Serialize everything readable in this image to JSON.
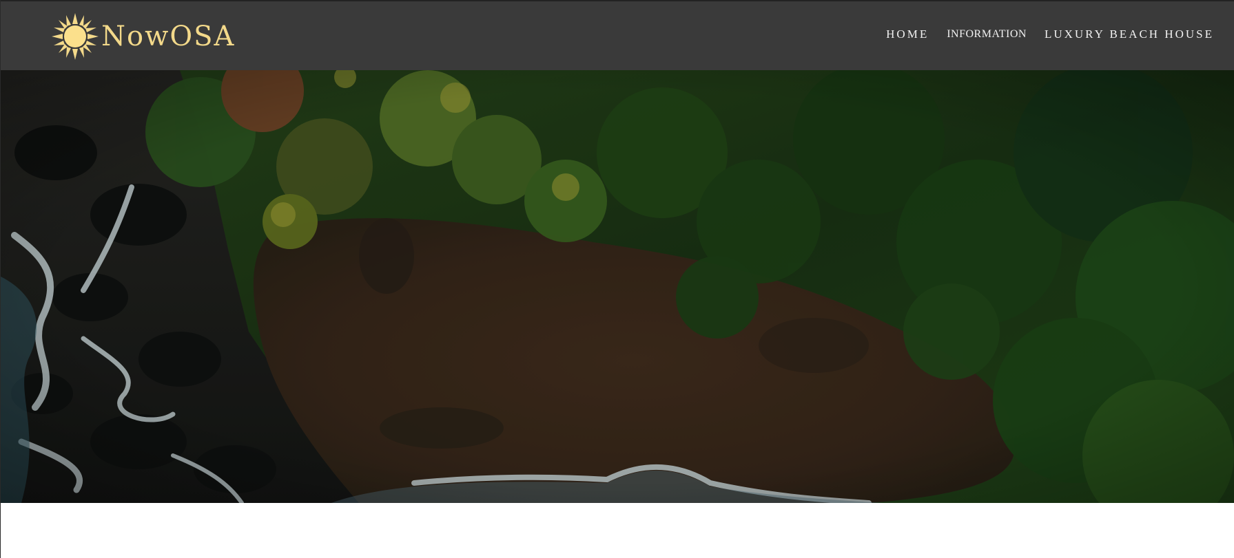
{
  "brand": {
    "name": "NowOSA",
    "logo_icon": "sun-icon",
    "logo_color": "#f3d98a"
  },
  "nav": {
    "items": [
      {
        "label": "HOME"
      },
      {
        "label": "INFORMATION"
      },
      {
        "label": "LUXURY BEACH HOUSE"
      }
    ]
  },
  "hero": {
    "description": "aerial-beach-jungle-photo",
    "colors": {
      "header_bg": "#3a3a3a",
      "sand": "#3b2a1c",
      "foliage": "#1f3a17",
      "rock": "#1e1f1d",
      "surf": "#d6e4e6"
    }
  }
}
